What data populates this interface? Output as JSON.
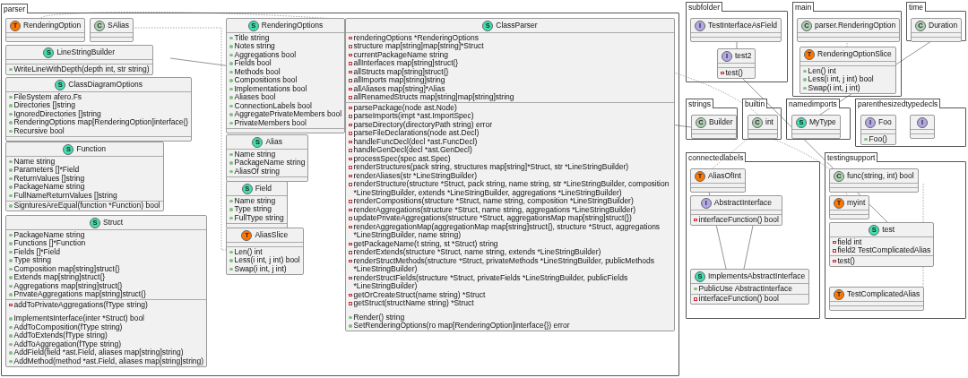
{
  "packages": [
    {
      "name": "parser",
      "classes": [
        {
          "kind": "alias",
          "letter": "T",
          "name": "RenderingOption"
        },
        {
          "kind": "class",
          "letter": "C",
          "name": "SAlias"
        },
        {
          "kind": "struct",
          "letter": "S",
          "name": "LineStringBuilder",
          "method_groups": [
            [
              {
                "private": false,
                "text": "WriteLineWithDepth(depth int, str string)"
              }
            ]
          ]
        },
        {
          "kind": "struct",
          "letter": "S",
          "name": "ClassDiagramOptions",
          "fields": [
            {
              "private": false,
              "text": "FileSystem afero.Fs"
            },
            {
              "private": false,
              "text": "Directories []string"
            },
            {
              "private": false,
              "text": "IgnoredDirectories []string"
            },
            {
              "private": false,
              "text": "RenderingOptions map[RenderingOption]interface{}"
            },
            {
              "private": false,
              "text": "Recursive bool"
            }
          ]
        },
        {
          "kind": "struct",
          "letter": "S",
          "name": "Function",
          "fields": [
            {
              "private": false,
              "text": "Name string"
            },
            {
              "private": false,
              "text": "Parameters []*Field"
            },
            {
              "private": false,
              "text": "ReturnValues []string"
            },
            {
              "private": false,
              "text": "PackageName string"
            },
            {
              "private": false,
              "text": "FullNameReturnValues []string"
            }
          ],
          "method_groups": [
            [
              {
                "private": false,
                "text": "SignturesAreEqual(function *Function) bool"
              }
            ]
          ]
        },
        {
          "kind": "struct",
          "letter": "S",
          "name": "Struct",
          "fields": [
            {
              "private": false,
              "text": "PackageName string"
            },
            {
              "private": false,
              "text": "Functions []*Function"
            },
            {
              "private": false,
              "text": "Fields []*Field"
            },
            {
              "private": false,
              "text": "Type string"
            },
            {
              "private": false,
              "text": "Composition map[string]struct{}"
            },
            {
              "private": false,
              "text": "Extends map[string]struct{}"
            },
            {
              "private": false,
              "text": "Aggregations map[string]struct{}"
            },
            {
              "private": false,
              "text": "PrivateAggregations map[string]struct{}"
            }
          ],
          "method_groups": [
            [
              {
                "private": true,
                "text": "addToPrivateAggregations(fType string)"
              }
            ],
            [
              {
                "private": false,
                "text": "ImplementsInterface(inter *Struct) bool"
              },
              {
                "private": false,
                "text": "AddToComposition(fType string)"
              },
              {
                "private": false,
                "text": "AddToExtends(fType string)"
              },
              {
                "private": false,
                "text": "AddToAggregation(fType string)"
              },
              {
                "private": false,
                "text": "AddField(field *ast.Field, aliases map[string]string)"
              },
              {
                "private": false,
                "text": "AddMethod(method *ast.Field, aliases map[string]string)"
              }
            ]
          ]
        },
        {
          "kind": "struct",
          "letter": "S",
          "name": "RenderingOptions",
          "fields": [
            {
              "private": false,
              "text": "Title string"
            },
            {
              "private": false,
              "text": "Notes string"
            },
            {
              "private": false,
              "text": "Aggregations bool"
            },
            {
              "private": false,
              "text": "Fields bool"
            },
            {
              "private": false,
              "text": "Methods bool"
            },
            {
              "private": false,
              "text": "Compositions bool"
            },
            {
              "private": false,
              "text": "Implementations bool"
            },
            {
              "private": false,
              "text": "Aliases bool"
            },
            {
              "private": false,
              "text": "ConnectionLabels bool"
            },
            {
              "private": false,
              "text": "AggregatePrivateMembers bool"
            },
            {
              "private": false,
              "text": "PrivateMembers bool"
            }
          ]
        },
        {
          "kind": "struct",
          "letter": "S",
          "name": "Alias",
          "fields": [
            {
              "private": false,
              "text": "Name string"
            },
            {
              "private": false,
              "text": "PackageName string"
            },
            {
              "private": false,
              "text": "AliasOf string"
            }
          ]
        },
        {
          "kind": "struct",
          "letter": "S",
          "name": "Field",
          "fields": [
            {
              "private": false,
              "text": "Name string"
            },
            {
              "private": false,
              "text": "Type string"
            },
            {
              "private": false,
              "text": "FullType string"
            }
          ]
        },
        {
          "kind": "alias",
          "letter": "T",
          "name": "AliasSlice",
          "method_groups": [
            [
              {
                "private": false,
                "text": "Len() int"
              },
              {
                "private": false,
                "text": "Less(i int, j int) bool"
              },
              {
                "private": false,
                "text": "Swap(i int, j int)"
              }
            ]
          ]
        },
        {
          "kind": "struct",
          "letter": "S",
          "name": "ClassParser",
          "fields": [
            {
              "private": true,
              "text": "renderingOptions *RenderingOptions"
            },
            {
              "private": true,
              "text": "structure map[string]map[string]*Struct"
            },
            {
              "private": true,
              "text": "currentPackageName string"
            },
            {
              "private": true,
              "text": "allInterfaces map[string]struct{}"
            },
            {
              "private": true,
              "text": "allStructs map[string]struct{}"
            },
            {
              "private": true,
              "text": "allImports map[string]string"
            },
            {
              "private": true,
              "text": "allAliases map[string]*Alias"
            },
            {
              "private": true,
              "text": "allRenamedStructs map[string]map[string]string"
            }
          ],
          "method_groups": [
            [
              {
                "private": true,
                "text": "parsePackage(node ast.Node)"
              },
              {
                "private": true,
                "text": "parseImports(impt *ast.ImportSpec)"
              },
              {
                "private": true,
                "text": "parseDirectory(directoryPath string) error"
              },
              {
                "private": true,
                "text": "parseFileDeclarations(node ast.Decl)"
              },
              {
                "private": true,
                "text": "handleFuncDecl(decl *ast.FuncDecl)"
              },
              {
                "private": true,
                "text": "handleGenDecl(decl *ast.GenDecl)"
              },
              {
                "private": true,
                "text": "processSpec(spec ast.Spec)"
              },
              {
                "private": true,
                "text": "renderStructures(pack string, structures map[string]*Struct, str *LineStringBuilder)"
              },
              {
                "private": true,
                "text": "renderAliases(str *LineStringBuilder)"
              },
              {
                "private": true,
                "text": "renderStructure(structure *Struct, pack string, name string, str *LineStringBuilder, composition *LineStringBuilder, extends *LineStringBuilder, aggregations *LineStringBuilder)"
              },
              {
                "private": true,
                "text": "renderCompositions(structure *Struct, name string, composition *LineStringBuilder)"
              },
              {
                "private": true,
                "text": "renderAggregations(structure *Struct, name string, aggregations *LineStringBuilder)"
              },
              {
                "private": true,
                "text": "updatePrivateAggregations(structure *Struct, aggregationsMap map[string]struct{})"
              },
              {
                "private": true,
                "text": "renderAggregationMap(aggregationMap map[string]struct{}, structure *Struct, aggregations *LineStringBuilder, name string)"
              },
              {
                "private": true,
                "text": "getPackageName(t string, st *Struct) string"
              },
              {
                "private": true,
                "text": "renderExtends(structure *Struct, name string, extends *LineStringBuilder)"
              },
              {
                "private": true,
                "text": "renderStructMethods(structure *Struct, privateMethods *LineStringBuilder, publicMethods *LineStringBuilder)"
              },
              {
                "private": true,
                "text": "renderStructFields(structure *Struct, privateFields *LineStringBuilder, publicFields *LineStringBuilder)"
              },
              {
                "private": true,
                "text": "getOrCreateStruct(name string) *Struct"
              },
              {
                "private": true,
                "text": "getStruct(structName string) *Struct"
              }
            ],
            [
              {
                "private": false,
                "text": "Render() string"
              },
              {
                "private": false,
                "text": "SetRenderingOptions(ro map[RenderingOption]interface{}) error"
              }
            ]
          ]
        }
      ]
    },
    {
      "name": "subfolder",
      "classes": [
        {
          "kind": "interface",
          "letter": "I",
          "name": "TestInterfaceAsField"
        },
        {
          "kind": "interface",
          "letter": "I",
          "name": "test2",
          "method_groups": [
            [
              {
                "private": true,
                "text": "test()"
              }
            ]
          ]
        }
      ]
    },
    {
      "name": "main",
      "classes": [
        {
          "kind": "class",
          "letter": "C",
          "name": "parser.RenderingOption"
        },
        {
          "kind": "alias",
          "letter": "T",
          "name": "RenderingOptionSlice",
          "method_groups": [
            [
              {
                "private": false,
                "text": "Len() int"
              },
              {
                "private": false,
                "text": "Less(i int, j int) bool"
              },
              {
                "private": false,
                "text": "Swap(i int, j int)"
              }
            ]
          ]
        }
      ]
    },
    {
      "name": "time",
      "classes": [
        {
          "kind": "class",
          "letter": "C",
          "name": "Duration"
        }
      ]
    },
    {
      "name": "strings",
      "classes": [
        {
          "kind": "class",
          "letter": "C",
          "name": "Builder"
        }
      ]
    },
    {
      "name": "builtin",
      "classes": [
        {
          "kind": "class",
          "letter": "C",
          "name": "int"
        }
      ]
    },
    {
      "name": "namedimports",
      "classes": [
        {
          "kind": "struct",
          "letter": "S",
          "name": "MyType"
        }
      ]
    },
    {
      "name": "parenthesizedtypedecls",
      "classes": [
        {
          "kind": "interface",
          "letter": "I",
          "name": "Foo",
          "method_groups": [
            [
              {
                "private": false,
                "text": "Foo()"
              }
            ]
          ]
        },
        {
          "kind": "interface",
          "letter": "I"
        }
      ]
    },
    {
      "name": "connectedlabels",
      "classes": [
        {
          "kind": "alias",
          "letter": "T",
          "name": "AliasOfInt"
        },
        {
          "kind": "interface",
          "letter": "I",
          "name": "AbstractInterface",
          "method_groups": [
            [
              {
                "private": true,
                "text": "interfaceFunction() bool"
              }
            ]
          ]
        },
        {
          "kind": "struct",
          "letter": "S",
          "name": "ImplementsAbstractInterface",
          "fields": [
            {
              "private": false,
              "text": "PublicUse AbstractInterface"
            }
          ],
          "method_groups": [
            [
              {
                "private": true,
                "text": "interfaceFunction() bool"
              }
            ]
          ]
        }
      ]
    },
    {
      "name": "testingsupport",
      "classes": [
        {
          "kind": "class",
          "letter": "C",
          "name": "func(string, int) bool"
        },
        {
          "kind": "alias",
          "letter": "T",
          "name": "myint"
        },
        {
          "kind": "struct",
          "letter": "S",
          "name": "test",
          "fields": [
            {
              "private": true,
              "text": "field int"
            },
            {
              "private": true,
              "text": "field2 TestComplicatedAlias"
            }
          ],
          "method_groups": [
            [
              {
                "private": true,
                "text": "test()"
              }
            ]
          ]
        },
        {
          "kind": "alias",
          "letter": "T",
          "name": "TestComplicatedAlias"
        }
      ]
    }
  ]
}
